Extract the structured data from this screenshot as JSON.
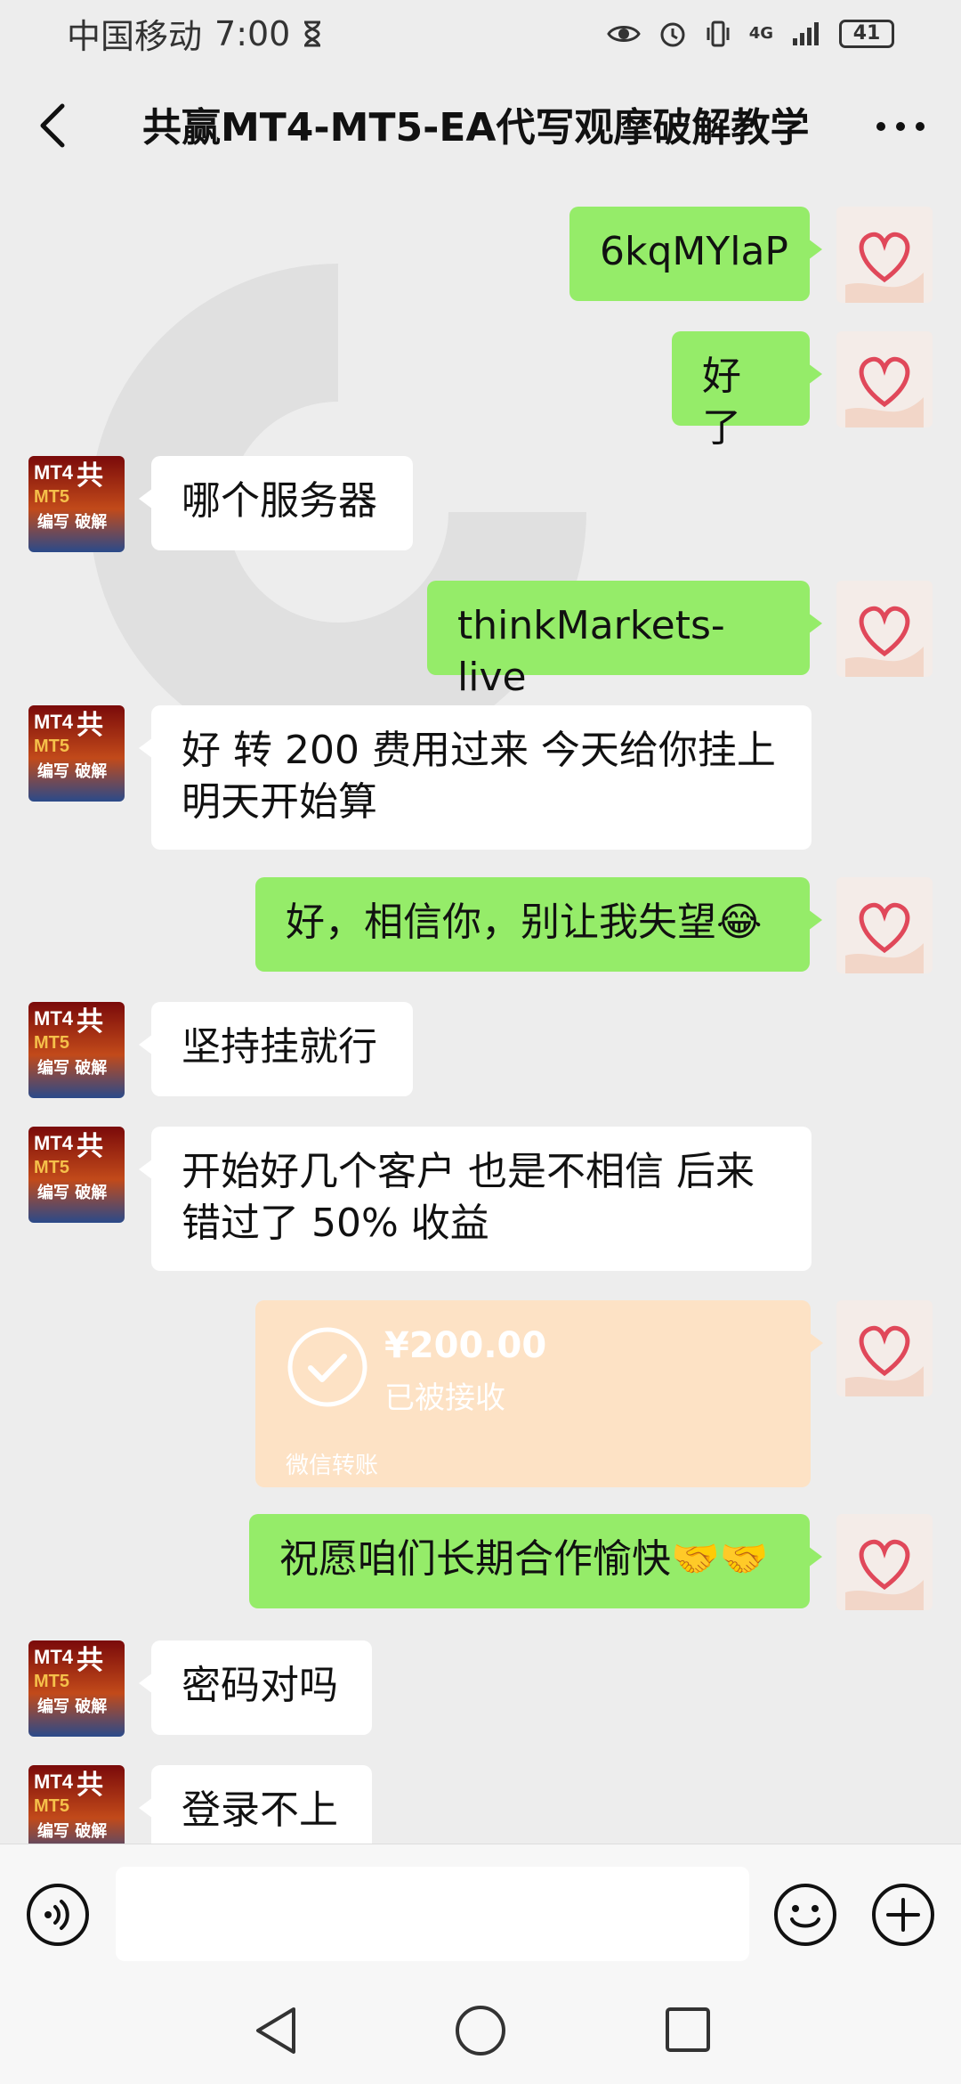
{
  "status_bar": {
    "carrier": "中国移动",
    "time": "7:00",
    "network": "4G",
    "battery": "41"
  },
  "header": {
    "title": "共赢MT4-MT5-EA代写观摩破解教学"
  },
  "avatars": {
    "them_lines": [
      "MT4",
      "共",
      "MT5",
      "编写 破解"
    ]
  },
  "messages": [
    {
      "sender": "me",
      "text": "6kqMYlaP"
    },
    {
      "sender": "me",
      "text": "好了"
    },
    {
      "sender": "them",
      "text": "哪个服务器"
    },
    {
      "sender": "me",
      "text": "thinkMarkets-live"
    },
    {
      "sender": "them",
      "lines": [
        "好 转 200 费用过来 今天给你挂上",
        "明天开始算"
      ]
    },
    {
      "sender": "me",
      "text": "好，相信你，别让我失望😂"
    },
    {
      "sender": "them",
      "text": "坚持挂就行"
    },
    {
      "sender": "them",
      "lines": [
        "开始好几个客户 也是不相信 后来",
        "错过了 50% 收益"
      ]
    },
    {
      "sender": "me",
      "text": "祝愿咱们长期合作愉快🤝🤝"
    },
    {
      "sender": "them",
      "text": "密码对吗"
    },
    {
      "sender": "them",
      "text": "登录不上"
    }
  ],
  "transfer": {
    "amount": "¥200.00",
    "status": "已被接收",
    "label": "微信转账"
  },
  "input": {
    "placeholder": ""
  }
}
